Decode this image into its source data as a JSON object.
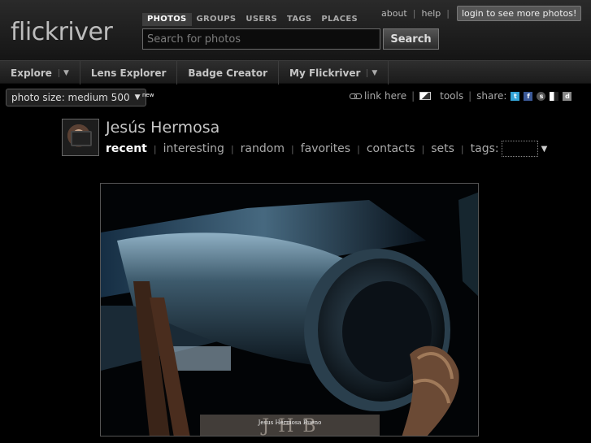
{
  "header": {
    "logo": "flickriver",
    "search_tabs": [
      "PHOTOS",
      "GROUPS",
      "USERS",
      "TAGS",
      "PLACES"
    ],
    "search_placeholder": "Search for photos",
    "search_button": "Search",
    "links": {
      "about": "about",
      "help": "help",
      "login": "login to see more photos!"
    }
  },
  "nav": {
    "items": [
      {
        "label": "Explore",
        "dropdown": true
      },
      {
        "label": "Lens Explorer",
        "dropdown": false
      },
      {
        "label": "Badge Creator",
        "dropdown": false
      },
      {
        "label": "My Flickriver",
        "dropdown": true
      }
    ]
  },
  "toolbar": {
    "photo_size": "photo size: medium 500",
    "new_badge": "new",
    "link_here": "link here",
    "tools": "tools",
    "share_label": "share:",
    "share_icons": [
      "twitter-icon",
      "facebook-icon",
      "stumbleupon-icon",
      "delicious-icon",
      "digg-icon"
    ]
  },
  "profile": {
    "name": "Jesús Hermosa",
    "tabs": [
      "recent",
      "interesting",
      "random",
      "favorites",
      "contacts",
      "sets",
      "tags:"
    ],
    "active_tab": "recent"
  },
  "photo": {
    "watermark_initials": "J H B",
    "watermark_text": "Jesus Hermosa Bueno"
  },
  "colors": {
    "accent": "#ffffff",
    "background": "#000000"
  }
}
